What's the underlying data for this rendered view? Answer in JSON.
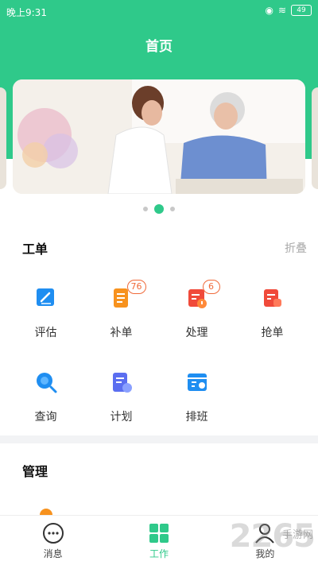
{
  "status_bar": {
    "time": "晚上9:31",
    "battery": "49"
  },
  "header": {
    "title": "首页"
  },
  "work_orders": {
    "title": "工单",
    "collapse_label": "折叠",
    "items": [
      {
        "label": "评估",
        "icon": "edit-icon",
        "badge": null
      },
      {
        "label": "补单",
        "icon": "document-icon",
        "badge": "76"
      },
      {
        "label": "处理",
        "icon": "process-icon",
        "badge": "6"
      },
      {
        "label": "抢单",
        "icon": "grab-order-icon",
        "badge": null
      },
      {
        "label": "查询",
        "icon": "search-icon",
        "badge": null
      },
      {
        "label": "计划",
        "icon": "plan-icon",
        "badge": null
      },
      {
        "label": "排班",
        "icon": "schedule-icon",
        "badge": null
      }
    ]
  },
  "management": {
    "title": "管理"
  },
  "tabbar": {
    "items": [
      {
        "label": "消息",
        "icon": "chat-icon"
      },
      {
        "label": "工作",
        "icon": "grid-icon",
        "active": true
      },
      {
        "label": "我的",
        "icon": "user-icon"
      }
    ]
  },
  "watermark": {
    "main": "2265",
    "sub": "手游网"
  },
  "colors": {
    "brand": "#2fc98a",
    "badge": "#f06a3a",
    "blue": "#1f8ef1",
    "orange": "#f7921e",
    "red": "#f04a3a"
  }
}
